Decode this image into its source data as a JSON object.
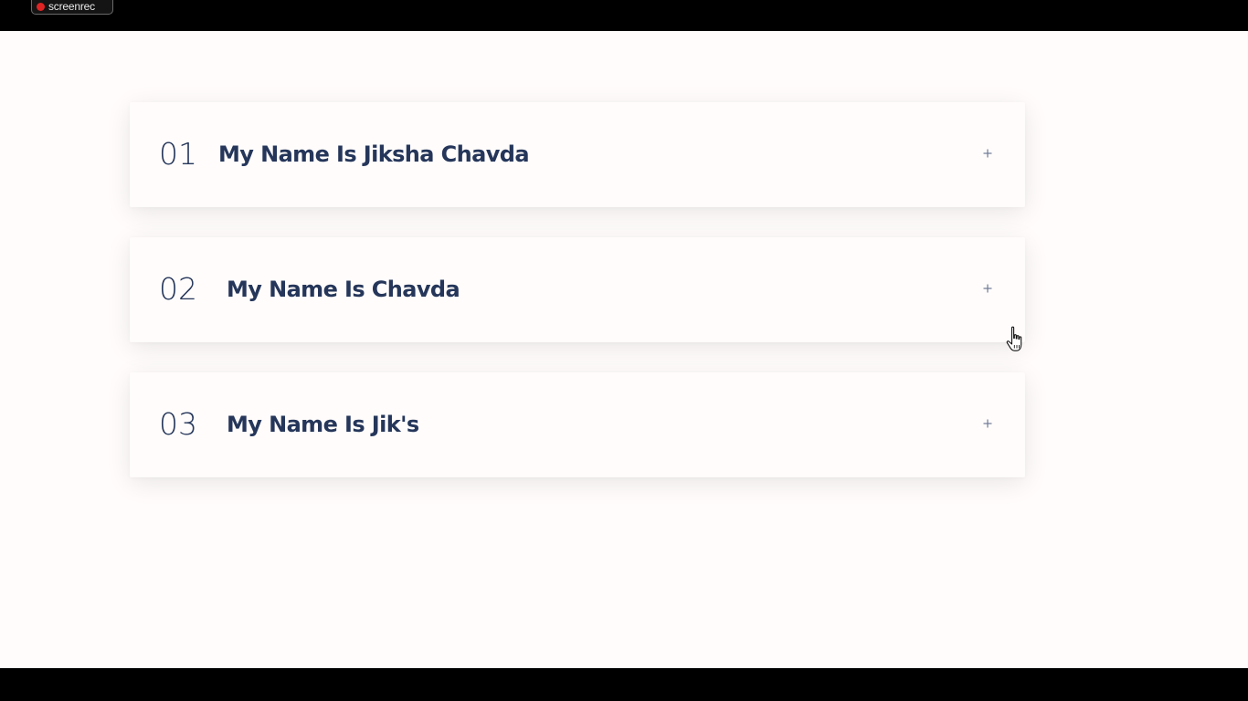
{
  "recorder": {
    "label": "screenrec"
  },
  "faq": {
    "items": [
      {
        "number": "01",
        "title": "My Name Is Jiksha Chavda"
      },
      {
        "number": "02",
        "title": "My Name Is Chavda"
      },
      {
        "number": "03",
        "title": "My Name Is Jik's"
      }
    ],
    "expand_icon": "plus-icon"
  },
  "colors": {
    "page_background": "#fffcfb",
    "heading_text": "#25365a",
    "recording_dot": "#e02424",
    "frame": "#000000"
  }
}
